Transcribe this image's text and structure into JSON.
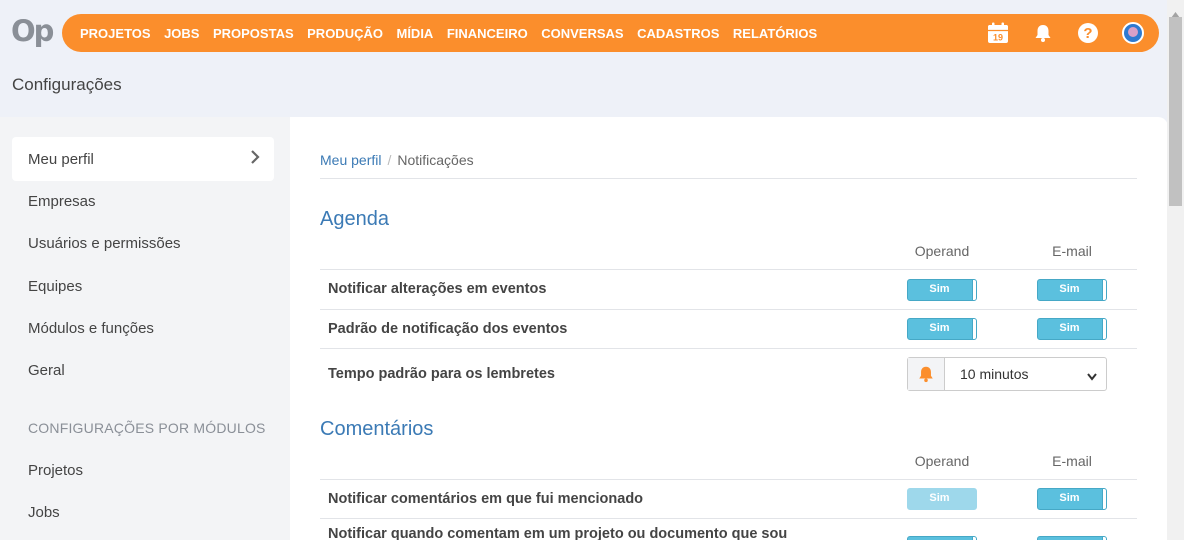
{
  "brand": {
    "logo_text": "Op",
    "accent": "#fb8e2c"
  },
  "nav": {
    "items": [
      "PROJETOS",
      "JOBS",
      "PROPOSTAS",
      "PRODUÇÃO",
      "MÍDIA",
      "FINANCEIRO",
      "CONVERSAS",
      "CADASTROS",
      "RELATÓRIOS"
    ]
  },
  "top_icons": {
    "calendar_day": "19",
    "icons": [
      "calendar-icon",
      "bell-icon",
      "help-icon",
      "avatar"
    ]
  },
  "page": {
    "title": "Configurações"
  },
  "sidebar": {
    "items": [
      {
        "label": "Meu perfil",
        "active": true
      },
      {
        "label": "Empresas"
      },
      {
        "label": "Usuários e permissões"
      },
      {
        "label": "Equipes"
      },
      {
        "label": "Módulos e funções"
      },
      {
        "label": "Geral"
      }
    ],
    "section_title": "CONFIGURAÇÕES POR MÓDULOS",
    "module_items": [
      {
        "label": "Projetos"
      },
      {
        "label": "Jobs"
      }
    ]
  },
  "breadcrumb": {
    "parent": "Meu perfil",
    "separator": "/",
    "current": "Notificações"
  },
  "sections": [
    {
      "title": "Agenda",
      "columns": [
        "Operand",
        "E-mail"
      ],
      "rows": [
        {
          "label": "Notificar alterações em eventos",
          "operand": "Sim",
          "email": "Sim"
        },
        {
          "label": "Padrão de notificação dos eventos",
          "operand": "Sim",
          "email": "Sim"
        },
        {
          "label": "Tempo padrão para os lembretes",
          "select_value": "10 minutos"
        }
      ]
    },
    {
      "title": "Comentários",
      "columns": [
        "Operand",
        "E-mail"
      ],
      "rows": [
        {
          "label": "Notificar comentários em que fui mencionado",
          "operand": "Sim",
          "email": "Sim",
          "operand_disabled": true
        },
        {
          "label": "Notificar quando comentam em um projeto ou documento que sou"
        }
      ]
    }
  ],
  "colors": {
    "toggle_on": "#5bc0de",
    "link": "#3b7ab5",
    "icon_orange": "#fb8e2c"
  }
}
